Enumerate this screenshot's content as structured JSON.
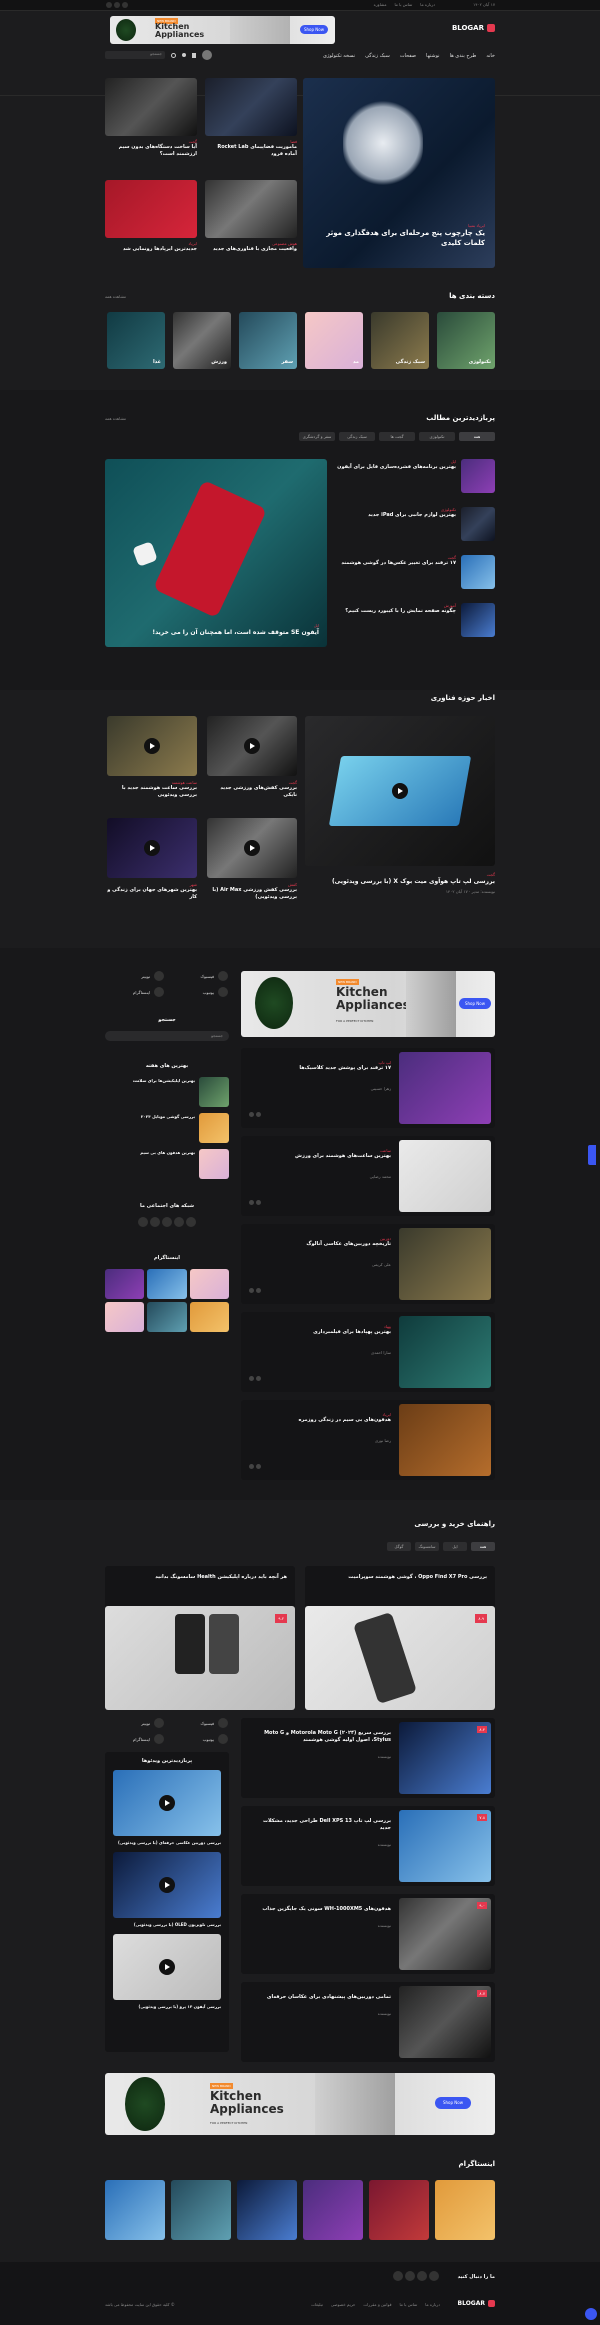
{
  "topbar": {
    "items": [
      "درباره ما",
      "تماس با ما",
      "مشاوره",
      "تبلیغات"
    ],
    "date": "۱۷ آبان ۱۴۰۲"
  },
  "ad": {
    "title": "Kitchen Appliances",
    "tag": "NEW BRAND",
    "sub": "FOR A PERFECT KITCHEN",
    "button": "Shop Now"
  },
  "logo": "BLOGAR",
  "nav": {
    "items": [
      "خانه",
      "طرح بندی ها",
      "نوشتها",
      "صفحات",
      "سبک زندگی",
      "نسخه تکنولوژی"
    ],
    "search_placeholder": "جستجو"
  },
  "hero": {
    "main_cat": "ایرپاد بمبیا",
    "main_title": "یک چارچوب پنج مرحله‌ای برای هدفگذاری موثر کلمات کلیدی",
    "cards": [
      {
        "cat": "فضا",
        "title": "ماموریت فضاپیمای Rocket Lab آماده فرود"
      },
      {
        "cat": "گجت",
        "title": "آیا ساخت دستگاه‌های بدون سیم ارزشمند است؟"
      },
      {
        "cat": "هوش مصنوعی",
        "title": "واقعیت مجازی با فناوری‌های جدید"
      },
      {
        "cat": "ایرپاد",
        "title": "جدیدترین ایرپادها رونمایی شد"
      }
    ]
  },
  "categories": {
    "title": "دسته بندی ها",
    "see_all": "مشاهده همه",
    "items": [
      "تکنولوژی",
      "سبک زندگی",
      "مد",
      "سفر",
      "ورزش",
      "غذا"
    ]
  },
  "popular": {
    "title": "پربازدیدترین مطالب",
    "see_all": "مشاهده همه",
    "tabs": [
      "همه",
      "تکنولوژی",
      "گجت ها",
      "سبک زندگی",
      "سفر و گردشگری"
    ],
    "feature_cat": "اپل",
    "feature_title": "آیفون SE متوقف شده است، اما همچنان آن را می خرید!",
    "list": [
      {
        "cat": "اپل",
        "title": "بهترین برنامه‌های فشرده‌سازی فایل برای آیفون"
      },
      {
        "cat": "تکنولوژی",
        "title": "بهترین لوازم جانبی برای iPad جدید"
      },
      {
        "cat": "گجت",
        "title": "۱۷ ترفند برای تغییر عکس‌ها در گوشی هوشمند"
      },
      {
        "cat": "آموزش",
        "title": "چگونه صفحه نمایش را با کیبورد ریست کنیم؟"
      }
    ]
  },
  "tech": {
    "title": "اخبار حوزه فناوری",
    "feature_cat": "گجت",
    "feature_title": "بررسی لپ تاپ هوآوی میت بوک X (با بررسی ویدئویی)",
    "feature_author": "نویسنده: مدیر",
    "feature_date": "۱۷ آبان ۱۴۰۲",
    "cards": [
      {
        "cat": "گجت",
        "title": "بررسی کفش‌های ورزشی جدید نایکی"
      },
      {
        "cat": "ساعت هوشمند",
        "title": "بررسی ساعت هوشمند جدید با بررسی ویدئویی"
      },
      {
        "cat": "کفش",
        "title": "بررسی کفش ورزشی Air Max (با بررسی ویدئویی)"
      },
      {
        "cat": "شهر",
        "title": "بهترین شهرهای جهان برای زندگی و کار"
      }
    ]
  },
  "sidebar": {
    "social": [
      {
        "name": "فیسبوک",
        "count": "۱.۲k"
      },
      {
        "name": "توییتر",
        "count": "۲.۵k"
      },
      {
        "name": "یوتیوب",
        "count": "۳.۱k"
      },
      {
        "name": "اینستاگرام",
        "count": "۴.۷k"
      }
    ],
    "search_title": "جستجو",
    "search_placeholder": "جستجو",
    "best_week": "بهترین های هفته",
    "best": [
      {
        "title": "بهترین اپلیکیشن‌ها برای سلامت"
      },
      {
        "title": "بررسی گوشی موبایل ۲۰۲۴"
      },
      {
        "title": "بهترین هدفون های بی سیم"
      }
    ],
    "social_title": "شبکه های اجتماعی ما",
    "insta_title": "اینستاگرام"
  },
  "feed": [
    {
      "cat": "لپ تاپ",
      "title": "۱۷ ترفند برای پوشش جدید کلاسیک‌ها",
      "author": "زهرا حسینی"
    },
    {
      "cat": "ساعت",
      "title": "بهترین ساعت‌های هوشمند برای ورزش",
      "author": "محمد رضایی"
    },
    {
      "cat": "دوربین",
      "title": "تاریخچه دوربین‌های عکاسی آنالوگ",
      "author": "علی کریمی"
    },
    {
      "cat": "پهپاد",
      "title": "بهترین پهپادها برای فیلمبرداری",
      "author": "سارا احمدی"
    },
    {
      "cat": "ایرپاد",
      "title": "هدفون‌های بی سیم در زندگی روزمره",
      "author": "رضا نوری"
    }
  ],
  "reviews": {
    "title": "راهنمای خرید و بررسی",
    "tabs": [
      "همه",
      "اپل",
      "سامسونگ",
      "گوگل"
    ],
    "top": [
      {
        "title": "بررسی Oppo Find X7 Pro ، گوشی هوشمند سوپرامیت",
        "score": "۸.۹"
      },
      {
        "title": "هر آنچه باید درباره اپلیکیشن Health سامسونگ بدانید",
        "score": "۹.۲"
      }
    ],
    "list": [
      {
        "title": "بررسی سریع Motorola Moto G (۲۰۲۴) و Moto G Stylus، اصول اولیه گوشی هوشمند",
        "author": "نویسنده",
        "score": "۸.۴"
      },
      {
        "title": "بررسی لپ تاپ Dell XPS 13 طراحی جدید، مشکلات جدید",
        "author": "نویسنده",
        "score": "۷.۸"
      },
      {
        "title": "هدفون‌های WH-1000XM5 سونی یک جایگزین جذاب",
        "author": "نویسنده",
        "score": "۹.۰"
      },
      {
        "title": "تمامی دوربین‌های پیشنهادی برای عکاسان حرفه‌ای",
        "author": "نویسنده",
        "score": "۸.۷"
      }
    ],
    "videos_title": "پربازدیدترین ویدئوها",
    "videos": [
      {
        "title": "بررسی دوربین عکاسی حرفه‌ای (با بررسی ویدئویی)"
      },
      {
        "title": "بررسی تلویزیون OLED (با بررسی ویدئویی)"
      },
      {
        "title": "بررسی آیفون ۱۴ پرو (با بررسی ویدئویی)"
      }
    ]
  },
  "instagram": {
    "title": "اینستاگرام"
  },
  "footer": {
    "logo": "BLOGAR",
    "follow": "ما را دنبال کنید",
    "links": [
      "درباره ما",
      "تماس با ما",
      "قوانین و مقررات",
      "حریم خصوصی",
      "تبلیغات"
    ],
    "copy": "© کلیه حقوق این سایت محفوظ می باشد"
  },
  "colors": {
    "accent": "#e5394f",
    "button": "#3b56f2"
  }
}
